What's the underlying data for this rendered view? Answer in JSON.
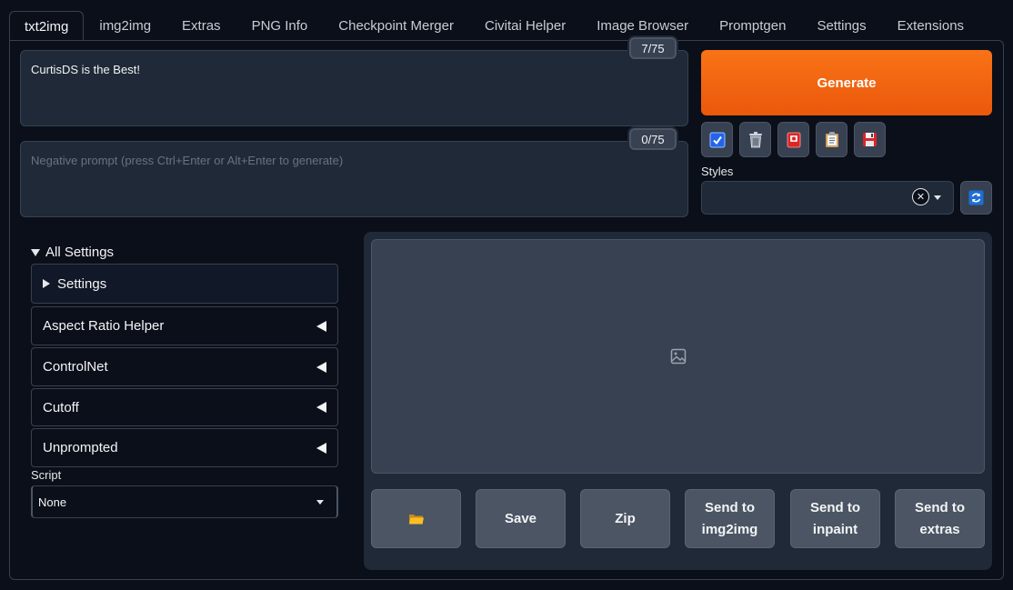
{
  "tabs": [
    "txt2img",
    "img2img",
    "Extras",
    "PNG Info",
    "Checkpoint Merger",
    "Civitai Helper",
    "Image Browser",
    "Promptgen",
    "Settings",
    "Extensions"
  ],
  "prompt": {
    "value": "CurtisDS is the Best!",
    "counter": "7/75"
  },
  "negative_prompt": {
    "placeholder": "Negative prompt (press Ctrl+Enter or Alt+Enter to generate)",
    "counter": "0/75"
  },
  "generate_label": "Generate",
  "toolbar_icons": [
    "checkbox-icon",
    "trash-icon",
    "card-icon",
    "clipboard-icon",
    "save-icon"
  ],
  "styles": {
    "label": "Styles",
    "value": "",
    "clear": "✕"
  },
  "settings_panel": {
    "title": "All Settings",
    "settings_label": "Settings",
    "accordions": [
      "Aspect Ratio Helper",
      "ControlNet",
      "Cutoff",
      "Unprompted"
    ]
  },
  "script": {
    "label": "Script",
    "value": "None"
  },
  "output_buttons": {
    "folder_icon": "folder-icon",
    "save": "Save",
    "zip": "Zip",
    "send_img2img": "Send to img2img",
    "send_inpaint": "Send to inpaint",
    "send_extras": "Send to extras"
  },
  "colors": {
    "accent": "#f97316",
    "background": "#0b0f19",
    "panel": "#1f2937"
  }
}
